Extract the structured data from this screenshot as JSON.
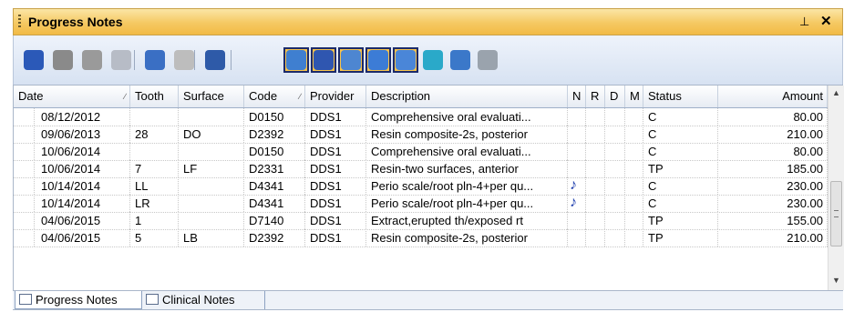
{
  "panel": {
    "title": "Progress Notes",
    "pin_glyph": "⊥",
    "close_glyph": "✕"
  },
  "toolbar": {
    "buttons": [
      {
        "icon": "check-circle-icon",
        "color": "#2b59b8",
        "boxed": false
      },
      {
        "icon": "trash-icon",
        "color": "#8a8a8a",
        "boxed": false
      },
      {
        "icon": "tools-icon",
        "color": "#9a9a9a",
        "boxed": false
      },
      {
        "icon": "printer-icon",
        "color": "#b7bcc6",
        "boxed": false
      },
      {
        "icon": "people-icon",
        "color": "#3a6fc4",
        "boxed": false
      },
      {
        "icon": "glasses-icon",
        "color": "#bdbdbd",
        "boxed": false
      },
      {
        "icon": "import-icon",
        "color": "#2e5aa8",
        "boxed": false
      },
      {
        "icon": "note-icon",
        "color": "#3f7fd0",
        "boxed": true
      },
      {
        "icon": "clock-icon",
        "color": "#2f56b0",
        "boxed": true
      },
      {
        "icon": "document-icon",
        "color": "#4d86d1",
        "boxed": true
      },
      {
        "icon": "search-icon",
        "color": "#3c7cd6",
        "boxed": true
      },
      {
        "icon": "patient-icon",
        "color": "#4a86d8",
        "boxed": true
      },
      {
        "icon": "arrow-right-icon",
        "color": "#2aa9c9",
        "boxed": false
      },
      {
        "icon": "window-icon",
        "color": "#3b78c9",
        "boxed": false
      },
      {
        "icon": "list-icon",
        "color": "#9aa3ad",
        "boxed": false
      }
    ]
  },
  "grid": {
    "columns": [
      "Date",
      "Tooth",
      "Surface",
      "Code",
      "Provider",
      "Description",
      "N",
      "R",
      "D",
      "M",
      "Status",
      "Amount"
    ],
    "rows": [
      {
        "date": "08/12/2012",
        "tooth": "",
        "surface": "",
        "code": "D0150",
        "provider": "DDS1",
        "description": "Comprehensive oral evaluati...",
        "n": "",
        "r": "",
        "d": "",
        "m": "",
        "status": "C",
        "amount": "80.00"
      },
      {
        "date": "09/06/2013",
        "tooth": "28",
        "surface": "DO",
        "code": "D2392",
        "provider": "DDS1",
        "description": "Resin composite-2s, posterior",
        "n": "",
        "r": "",
        "d": "",
        "m": "",
        "status": "C",
        "amount": "210.00"
      },
      {
        "date": "10/06/2014",
        "tooth": "",
        "surface": "",
        "code": "D0150",
        "provider": "DDS1",
        "description": "Comprehensive oral evaluati...",
        "n": "",
        "r": "",
        "d": "",
        "m": "",
        "status": "C",
        "amount": "80.00"
      },
      {
        "date": "10/06/2014",
        "tooth": "7",
        "surface": "LF",
        "code": "D2331",
        "provider": "DDS1",
        "description": "Resin-two surfaces, anterior",
        "n": "",
        "r": "",
        "d": "",
        "m": "",
        "status": "TP",
        "amount": "185.00"
      },
      {
        "date": "10/14/2014",
        "tooth": "LL",
        "surface": "",
        "code": "D4341",
        "provider": "DDS1",
        "description": "Perio scale/root pln-4+per qu...",
        "n": "♪",
        "r": "",
        "d": "",
        "m": "",
        "status": "C",
        "amount": "230.00"
      },
      {
        "date": "10/14/2014",
        "tooth": "LR",
        "surface": "",
        "code": "D4341",
        "provider": "DDS1",
        "description": "Perio scale/root pln-4+per qu...",
        "n": "♪",
        "r": "",
        "d": "",
        "m": "",
        "status": "C",
        "amount": "230.00"
      },
      {
        "date": "04/06/2015",
        "tooth": "1",
        "surface": "",
        "code": "D7140",
        "provider": "DDS1",
        "description": "Extract,erupted th/exposed rt",
        "n": "",
        "r": "",
        "d": "",
        "m": "",
        "status": "TP",
        "amount": "155.00"
      },
      {
        "date": "04/06/2015",
        "tooth": "5",
        "surface": "LB",
        "code": "D2392",
        "provider": "DDS1",
        "description": "Resin composite-2s, posterior",
        "n": "",
        "r": "",
        "d": "",
        "m": "",
        "status": "TP",
        "amount": "210.00"
      }
    ]
  },
  "tabs": [
    {
      "label": "Progress Notes",
      "active": true
    },
    {
      "label": "Clinical Notes",
      "active": false
    }
  ]
}
